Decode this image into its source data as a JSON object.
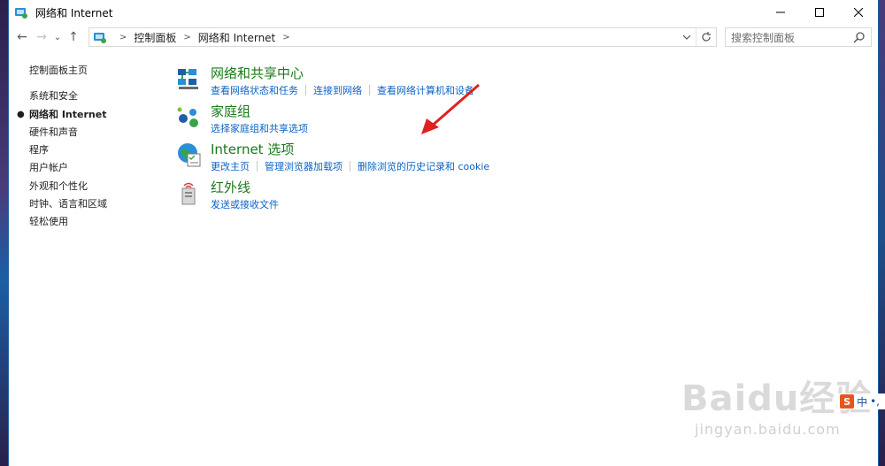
{
  "window": {
    "title": "网络和 Internet"
  },
  "caption": {
    "minimize": "—",
    "maximize": "☐",
    "close": "✕"
  },
  "nav": {
    "back": "←",
    "forward": "→",
    "recent": "⌄",
    "up": "↑"
  },
  "address": {
    "crumbs": [
      "控制面板",
      "网络和 Internet"
    ]
  },
  "search": {
    "placeholder": "搜索控制面板"
  },
  "sidebar": {
    "items": [
      {
        "label": "控制面板主页"
      },
      {
        "label": "系统和安全"
      },
      {
        "label": "网络和 Internet",
        "active": true
      },
      {
        "label": "硬件和声音"
      },
      {
        "label": "程序"
      },
      {
        "label": "用户帐户"
      },
      {
        "label": "外观和个性化"
      },
      {
        "label": "时钟、语言和区域"
      },
      {
        "label": "轻松使用"
      }
    ]
  },
  "categories": [
    {
      "title": "网络和共享中心",
      "icon": "network-sharing-icon",
      "links": [
        "查看网络状态和任务",
        "连接到网络",
        "查看网络计算机和设备"
      ]
    },
    {
      "title": "家庭组",
      "icon": "homegroup-icon",
      "links": [
        "选择家庭组和共享选项"
      ]
    },
    {
      "title": "Internet 选项",
      "icon": "internet-options-icon",
      "links": [
        "更改主页",
        "管理浏览器加载项",
        "删除浏览的历史记录和 cookie"
      ]
    },
    {
      "title": "红外线",
      "icon": "infrared-icon",
      "links": [
        "发送或接收文件"
      ]
    }
  ],
  "watermark": {
    "logo": "Baidu经验",
    "url": "jingyan.baidu.com"
  },
  "ime": {
    "badge": "S",
    "lang": "中",
    "punct": "•,"
  },
  "colors": {
    "link": "#0b63c5",
    "heading": "#1a7a1a",
    "annotation": "#e02020"
  }
}
